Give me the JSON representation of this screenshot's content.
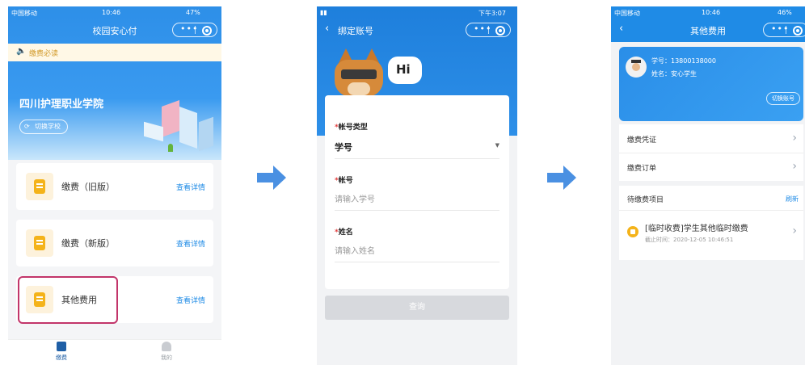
{
  "colors": {
    "primary": "#1f8be6",
    "accent": "#4a90e2",
    "notice_bg": "#fff8e6",
    "warn": "#f4b31a",
    "highlight": "#c2356a"
  },
  "screen1": {
    "status": {
      "carrier": "中国移动",
      "time": "10:46",
      "battery": "47%"
    },
    "title": "校园安心付",
    "notice": "缴费必读",
    "school": "四川护理职业学院",
    "switch_school": "切换学校",
    "items": [
      {
        "label": "缴费（旧版）",
        "link": "查看详情"
      },
      {
        "label": "缴费（新版）",
        "link": "查看详情"
      },
      {
        "label": "其他费用",
        "link": "查看详情"
      }
    ],
    "tabs": [
      {
        "label": "缴费"
      },
      {
        "label": "我的"
      }
    ]
  },
  "screen2": {
    "status": {
      "time": "下午3:07"
    },
    "title": "绑定账号",
    "hi": "Hi",
    "fields": [
      {
        "label": "帐号类型",
        "value": "学号"
      },
      {
        "label": "帐号",
        "placeholder": "请输入学号"
      },
      {
        "label": "姓名",
        "placeholder": "请输入姓名"
      }
    ],
    "required_mark": "*",
    "submit": "查询"
  },
  "screen3": {
    "status": {
      "carrier": "中国移动",
      "time": "10:46",
      "battery": "46%"
    },
    "title": "其他费用",
    "student_id": "学号：13800138000",
    "student_name": "姓名：安心学生",
    "switch_account": "切换账号",
    "menu": [
      {
        "label": "缴费凭证"
      },
      {
        "label": "缴费订单"
      }
    ],
    "pending_title": "待缴费项目",
    "refresh": "刷新",
    "pending_item": {
      "title": "[临时收费]学生其他临时缴费",
      "deadline": "截止时间：2020-12-05 10:46:51"
    }
  }
}
